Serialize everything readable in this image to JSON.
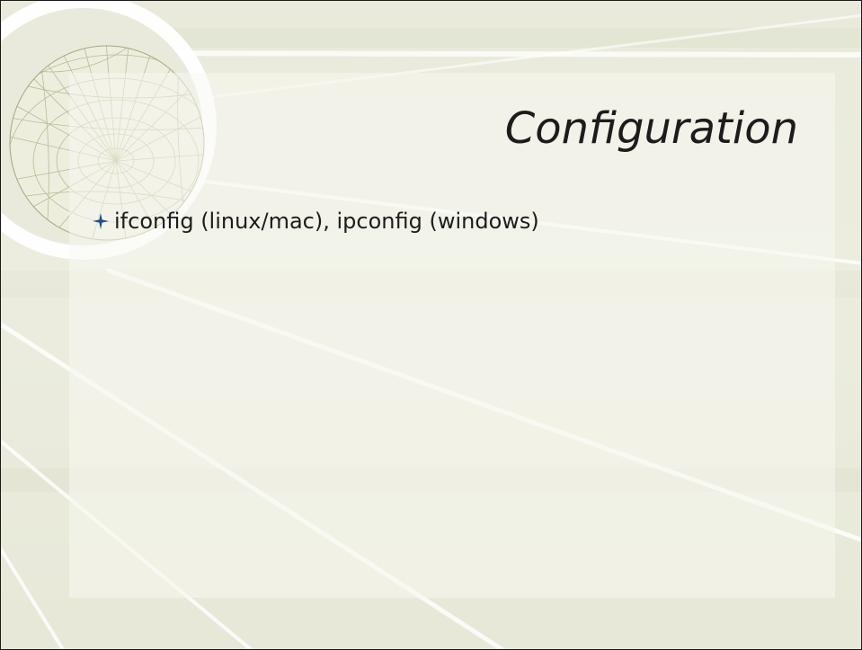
{
  "slide": {
    "title": "Configuration",
    "bullets": [
      {
        "text": "ifconfig (linux/mac), ipconfig (windows)",
        "icon": "four-point-star-icon"
      }
    ]
  },
  "theme": {
    "accent": "#1f4e8c",
    "background": "#eaebdc",
    "text": "#1c1c1c",
    "line": "#ffffff"
  }
}
